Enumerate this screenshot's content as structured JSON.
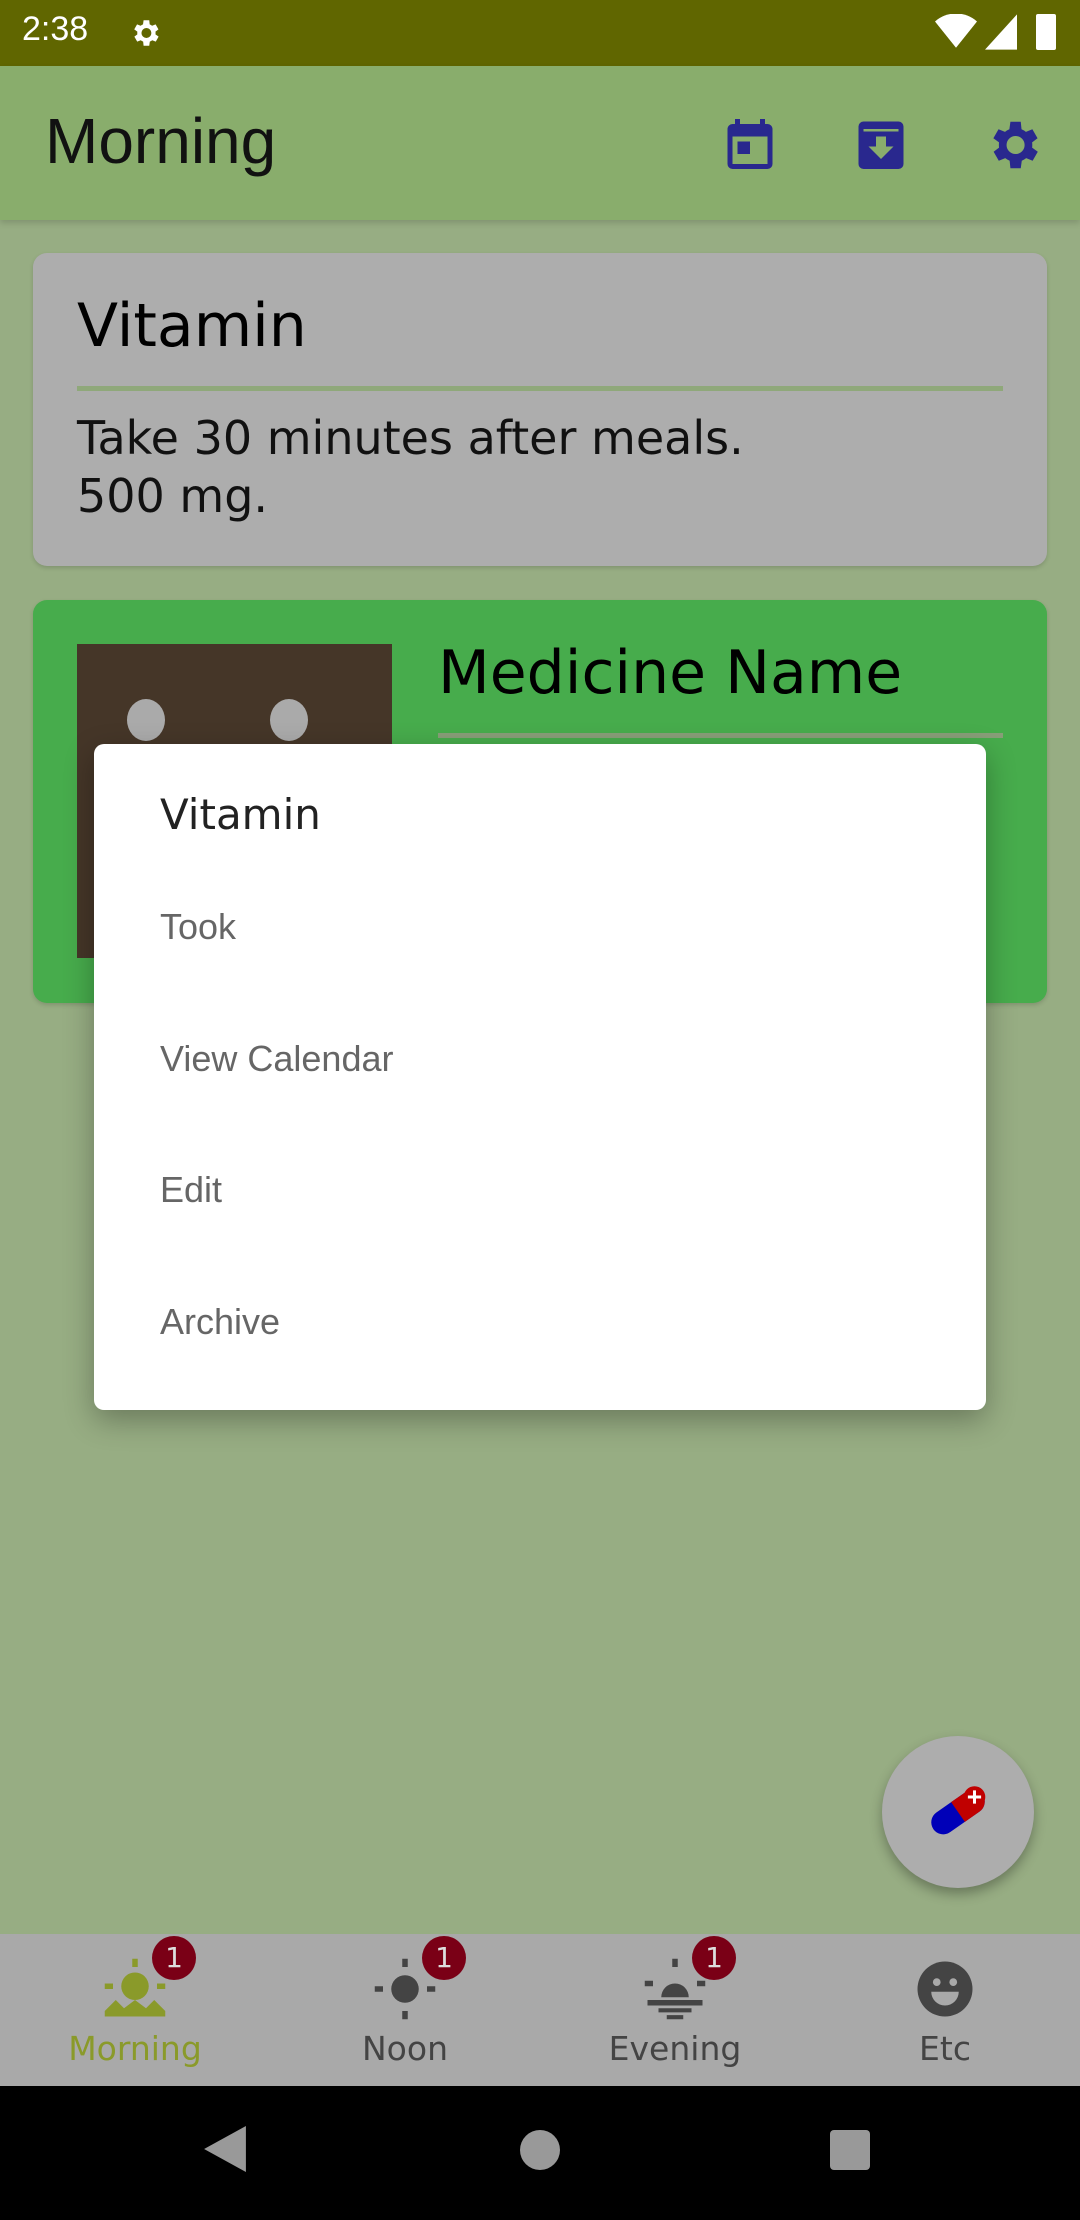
{
  "status_bar": {
    "time": "2:38"
  },
  "app_bar": {
    "title": "Morning",
    "icons": [
      "calendar-icon",
      "archive-icon",
      "settings-icon"
    ]
  },
  "cards": [
    {
      "title": "Vitamin",
      "lines": [
        "Take 30 minutes after meals.",
        "500 mg."
      ]
    },
    {
      "title": "Medicine Name"
    }
  ],
  "dialog": {
    "title": "Vitamin",
    "items": [
      "Took",
      "View Calendar",
      "Edit",
      "Archive"
    ]
  },
  "bottom_nav": {
    "tabs": [
      {
        "label": "Morning",
        "badge": "1",
        "active": true
      },
      {
        "label": "Noon",
        "badge": "1"
      },
      {
        "label": "Evening",
        "badge": "1"
      },
      {
        "label": "Etc"
      }
    ]
  },
  "colors": {
    "status_bar": "#606600",
    "app_bar": "#89ad6c",
    "accent_icons": "#29288e",
    "active_tab": "#8a9a2a",
    "badge": "#7a0016",
    "medicine_card": "#47ac4c"
  }
}
